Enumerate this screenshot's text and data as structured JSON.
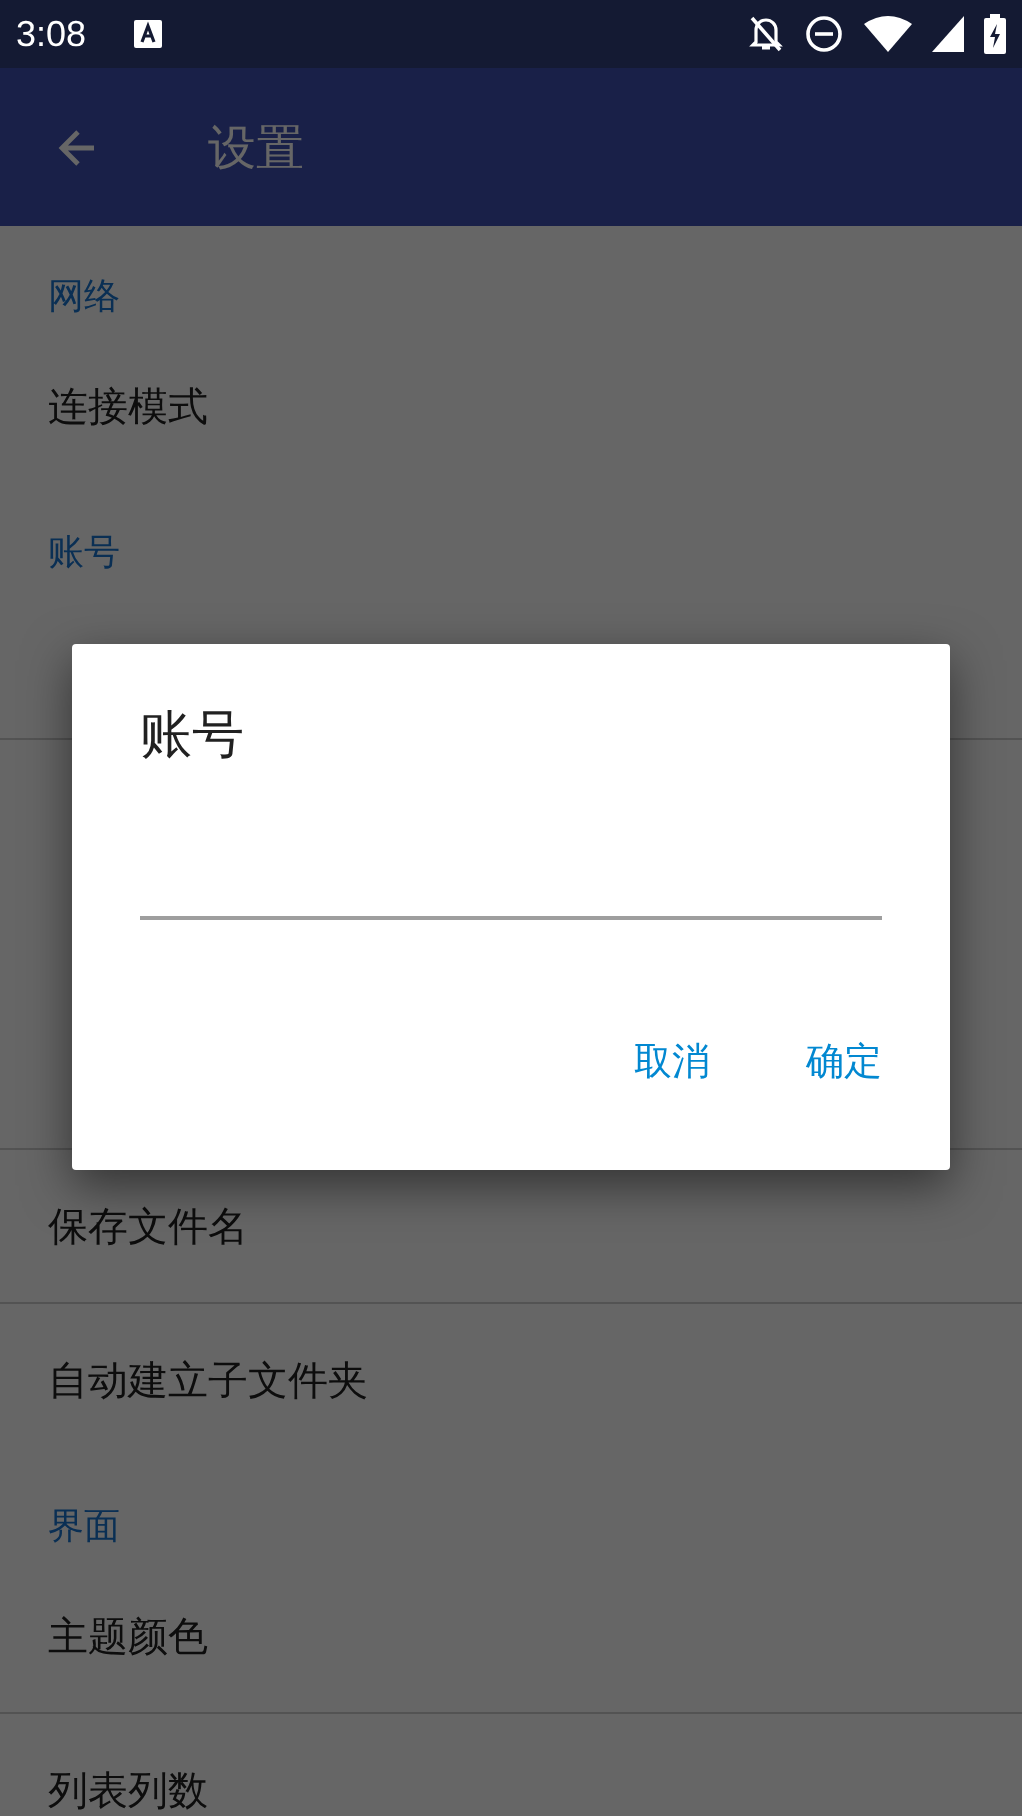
{
  "status_bar": {
    "time": "3:08"
  },
  "app_bar": {
    "title": "设置"
  },
  "settings": [
    {
      "kind": "header",
      "label": "网络"
    },
    {
      "kind": "item",
      "label": "连接模式"
    },
    {
      "kind": "header",
      "label": "账号"
    },
    {
      "kind": "covered"
    },
    {
      "kind": "covered"
    },
    {
      "kind": "covered_header"
    },
    {
      "kind": "covered"
    },
    {
      "kind": "item",
      "label": "保存文件名"
    },
    {
      "kind": "item",
      "label": "自动建立子文件夹"
    },
    {
      "kind": "header",
      "label": "界面"
    },
    {
      "kind": "item",
      "label": "主题颜色"
    },
    {
      "kind": "item",
      "label": "列表列数"
    }
  ],
  "dialog": {
    "title": "账号",
    "buttons": [
      "取消",
      "确定"
    ]
  }
}
